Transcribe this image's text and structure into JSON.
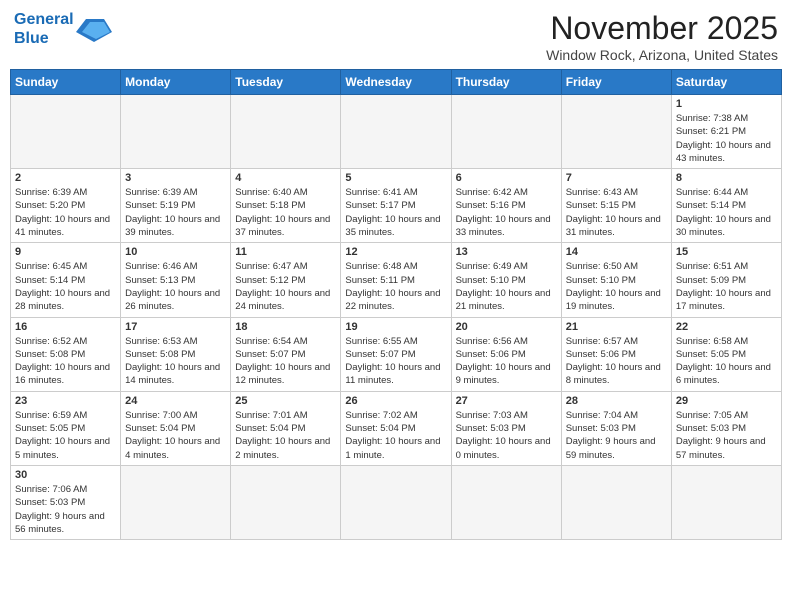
{
  "header": {
    "logo_line1": "General",
    "logo_line2": "Blue",
    "month": "November 2025",
    "location": "Window Rock, Arizona, United States"
  },
  "weekdays": [
    "Sunday",
    "Monday",
    "Tuesday",
    "Wednesday",
    "Thursday",
    "Friday",
    "Saturday"
  ],
  "weeks": [
    [
      {
        "day": "",
        "info": ""
      },
      {
        "day": "",
        "info": ""
      },
      {
        "day": "",
        "info": ""
      },
      {
        "day": "",
        "info": ""
      },
      {
        "day": "",
        "info": ""
      },
      {
        "day": "",
        "info": ""
      },
      {
        "day": "1",
        "info": "Sunrise: 7:38 AM\nSunset: 6:21 PM\nDaylight: 10 hours and 43 minutes."
      }
    ],
    [
      {
        "day": "2",
        "info": "Sunrise: 6:39 AM\nSunset: 5:20 PM\nDaylight: 10 hours and 41 minutes."
      },
      {
        "day": "3",
        "info": "Sunrise: 6:39 AM\nSunset: 5:19 PM\nDaylight: 10 hours and 39 minutes."
      },
      {
        "day": "4",
        "info": "Sunrise: 6:40 AM\nSunset: 5:18 PM\nDaylight: 10 hours and 37 minutes."
      },
      {
        "day": "5",
        "info": "Sunrise: 6:41 AM\nSunset: 5:17 PM\nDaylight: 10 hours and 35 minutes."
      },
      {
        "day": "6",
        "info": "Sunrise: 6:42 AM\nSunset: 5:16 PM\nDaylight: 10 hours and 33 minutes."
      },
      {
        "day": "7",
        "info": "Sunrise: 6:43 AM\nSunset: 5:15 PM\nDaylight: 10 hours and 31 minutes."
      },
      {
        "day": "8",
        "info": "Sunrise: 6:44 AM\nSunset: 5:14 PM\nDaylight: 10 hours and 30 minutes."
      }
    ],
    [
      {
        "day": "9",
        "info": "Sunrise: 6:45 AM\nSunset: 5:14 PM\nDaylight: 10 hours and 28 minutes."
      },
      {
        "day": "10",
        "info": "Sunrise: 6:46 AM\nSunset: 5:13 PM\nDaylight: 10 hours and 26 minutes."
      },
      {
        "day": "11",
        "info": "Sunrise: 6:47 AM\nSunset: 5:12 PM\nDaylight: 10 hours and 24 minutes."
      },
      {
        "day": "12",
        "info": "Sunrise: 6:48 AM\nSunset: 5:11 PM\nDaylight: 10 hours and 22 minutes."
      },
      {
        "day": "13",
        "info": "Sunrise: 6:49 AM\nSunset: 5:10 PM\nDaylight: 10 hours and 21 minutes."
      },
      {
        "day": "14",
        "info": "Sunrise: 6:50 AM\nSunset: 5:10 PM\nDaylight: 10 hours and 19 minutes."
      },
      {
        "day": "15",
        "info": "Sunrise: 6:51 AM\nSunset: 5:09 PM\nDaylight: 10 hours and 17 minutes."
      }
    ],
    [
      {
        "day": "16",
        "info": "Sunrise: 6:52 AM\nSunset: 5:08 PM\nDaylight: 10 hours and 16 minutes."
      },
      {
        "day": "17",
        "info": "Sunrise: 6:53 AM\nSunset: 5:08 PM\nDaylight: 10 hours and 14 minutes."
      },
      {
        "day": "18",
        "info": "Sunrise: 6:54 AM\nSunset: 5:07 PM\nDaylight: 10 hours and 12 minutes."
      },
      {
        "day": "19",
        "info": "Sunrise: 6:55 AM\nSunset: 5:07 PM\nDaylight: 10 hours and 11 minutes."
      },
      {
        "day": "20",
        "info": "Sunrise: 6:56 AM\nSunset: 5:06 PM\nDaylight: 10 hours and 9 minutes."
      },
      {
        "day": "21",
        "info": "Sunrise: 6:57 AM\nSunset: 5:06 PM\nDaylight: 10 hours and 8 minutes."
      },
      {
        "day": "22",
        "info": "Sunrise: 6:58 AM\nSunset: 5:05 PM\nDaylight: 10 hours and 6 minutes."
      }
    ],
    [
      {
        "day": "23",
        "info": "Sunrise: 6:59 AM\nSunset: 5:05 PM\nDaylight: 10 hours and 5 minutes."
      },
      {
        "day": "24",
        "info": "Sunrise: 7:00 AM\nSunset: 5:04 PM\nDaylight: 10 hours and 4 minutes."
      },
      {
        "day": "25",
        "info": "Sunrise: 7:01 AM\nSunset: 5:04 PM\nDaylight: 10 hours and 2 minutes."
      },
      {
        "day": "26",
        "info": "Sunrise: 7:02 AM\nSunset: 5:04 PM\nDaylight: 10 hours and 1 minute."
      },
      {
        "day": "27",
        "info": "Sunrise: 7:03 AM\nSunset: 5:03 PM\nDaylight: 10 hours and 0 minutes."
      },
      {
        "day": "28",
        "info": "Sunrise: 7:04 AM\nSunset: 5:03 PM\nDaylight: 9 hours and 59 minutes."
      },
      {
        "day": "29",
        "info": "Sunrise: 7:05 AM\nSunset: 5:03 PM\nDaylight: 9 hours and 57 minutes."
      }
    ],
    [
      {
        "day": "30",
        "info": "Sunrise: 7:06 AM\nSunset: 5:03 PM\nDaylight: 9 hours and 56 minutes."
      },
      {
        "day": "",
        "info": ""
      },
      {
        "day": "",
        "info": ""
      },
      {
        "day": "",
        "info": ""
      },
      {
        "day": "",
        "info": ""
      },
      {
        "day": "",
        "info": ""
      },
      {
        "day": "",
        "info": ""
      }
    ]
  ]
}
